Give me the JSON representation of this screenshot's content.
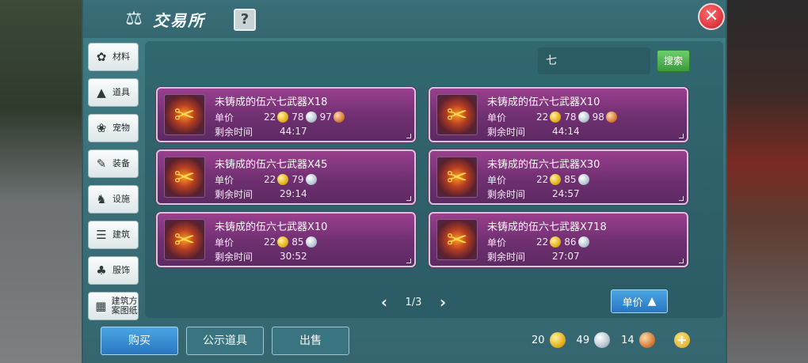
{
  "window": {
    "title": "交易所",
    "help_icon": "?",
    "close_icon": "✕"
  },
  "sidebar": {
    "items": [
      {
        "label": "材料",
        "icon": "material-icon"
      },
      {
        "label": "道具",
        "icon": "item-icon"
      },
      {
        "label": "宠物",
        "icon": "pet-icon"
      },
      {
        "label": "装备",
        "icon": "equipment-icon"
      },
      {
        "label": "设施",
        "icon": "facility-icon"
      },
      {
        "label": "建筑",
        "icon": "building-icon"
      },
      {
        "label": "服饰",
        "icon": "clothing-icon"
      },
      {
        "label": "建筑方案图纸",
        "icon": "blueprint-icon"
      }
    ]
  },
  "search": {
    "value": "七",
    "button_label": "搜索"
  },
  "labels": {
    "price": "单价",
    "time_left": "剩余时间"
  },
  "listings": [
    {
      "name": "未铸成的伍六七武器X18",
      "gold": "22",
      "silver": "78",
      "copper": "97",
      "time": "44:17"
    },
    {
      "name": "未铸成的伍六七武器X10",
      "gold": "22",
      "silver": "78",
      "copper": "98",
      "time": "44:14"
    },
    {
      "name": "未铸成的伍六七武器X45",
      "gold": "22",
      "silver": "79",
      "copper": null,
      "time": "29:14"
    },
    {
      "name": "未铸成的伍六七武器X30",
      "gold": "22",
      "silver": "85",
      "copper": null,
      "time": "24:57"
    },
    {
      "name": "未铸成的伍六七武器X10",
      "gold": "22",
      "silver": "85",
      "copper": null,
      "time": "30:52"
    },
    {
      "name": "未铸成的伍六七武器X718",
      "gold": "22",
      "silver": "86",
      "copper": null,
      "time": "27:07"
    }
  ],
  "pager": {
    "text": "1/3",
    "prev_icon": "‹",
    "next_icon": "›"
  },
  "sort": {
    "label": "单价"
  },
  "actions": {
    "buy": "购买",
    "public_items": "公示道具",
    "sell": "出售"
  },
  "wallet": {
    "gold": "20",
    "silver": "49",
    "copper": "14"
  },
  "colors": {
    "panel": "#3f7e86",
    "card": "#7a3278",
    "buy_button": "#3a8fd6",
    "search_button": "#4cb34e",
    "close_button": "#d9323c"
  }
}
